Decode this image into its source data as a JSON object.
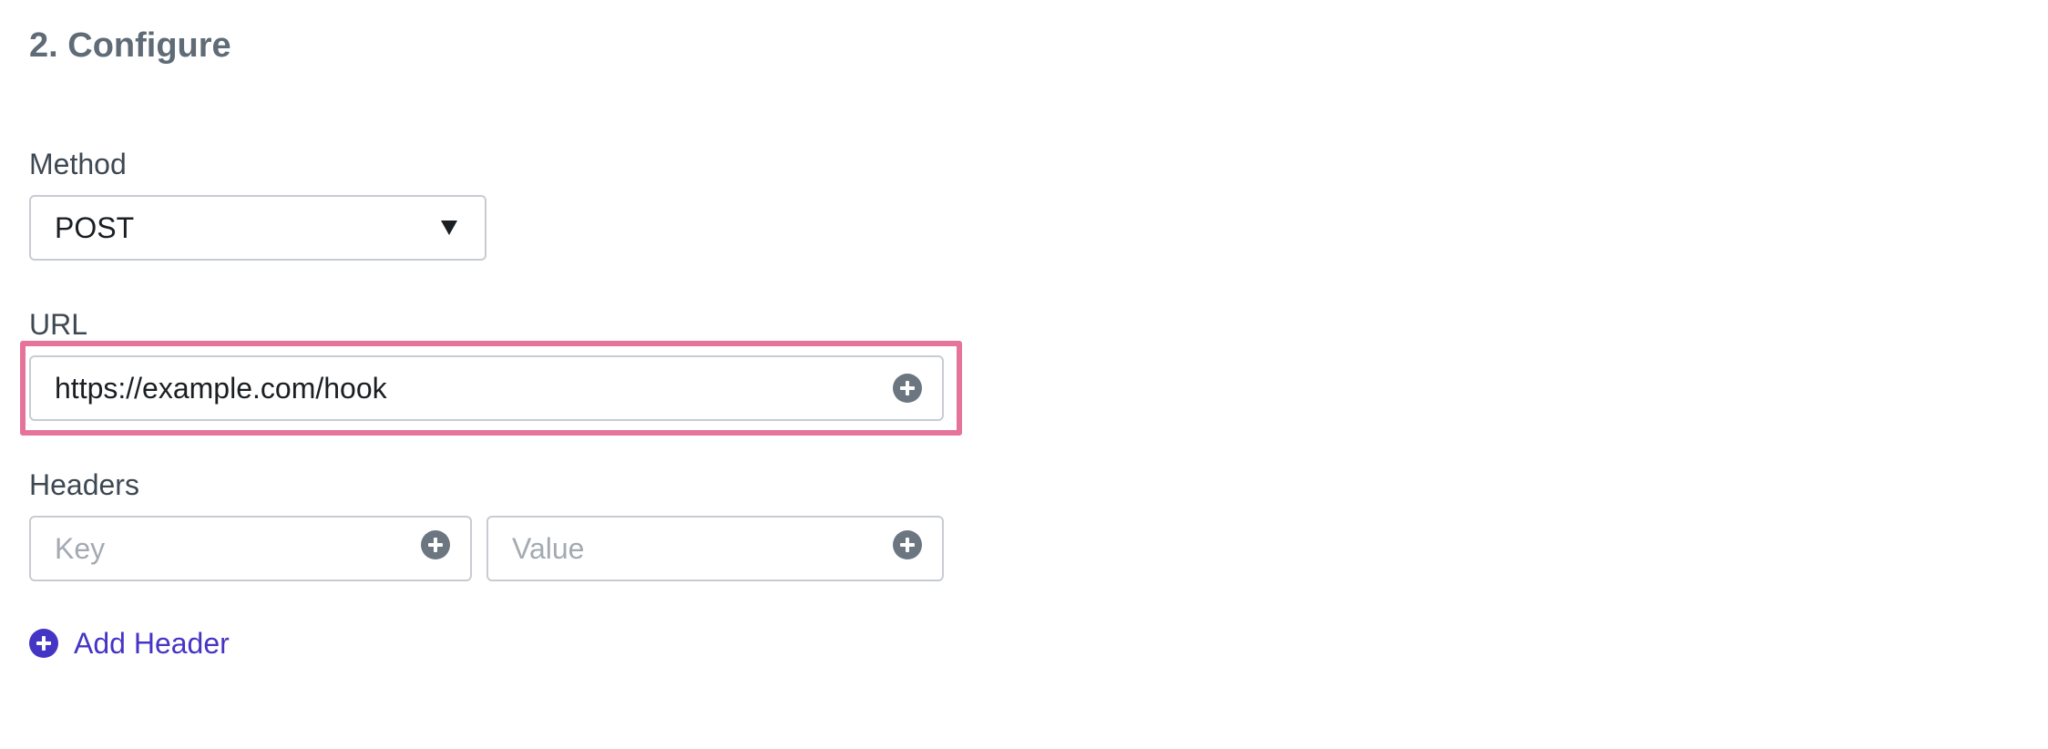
{
  "section": {
    "title": "2. Configure"
  },
  "method": {
    "label": "Method",
    "selected": "POST",
    "caret_icon": "triangle-down-icon"
  },
  "url": {
    "label": "URL",
    "value": "https://example.com/hook",
    "action_icon": "plus-circle-icon",
    "highlight_color": "#e6749a"
  },
  "headers": {
    "label": "Headers",
    "key_placeholder": "Key",
    "value_placeholder": "Value",
    "action_icon": "plus-circle-icon",
    "add_label": "Add Header",
    "add_icon": "plus-circle-icon"
  },
  "colors": {
    "accent": "#4535c4",
    "title": "#5f6b76",
    "icon_gray": "#6b7680",
    "border": "#c8ccd1",
    "placeholder": "#a3aab2"
  }
}
